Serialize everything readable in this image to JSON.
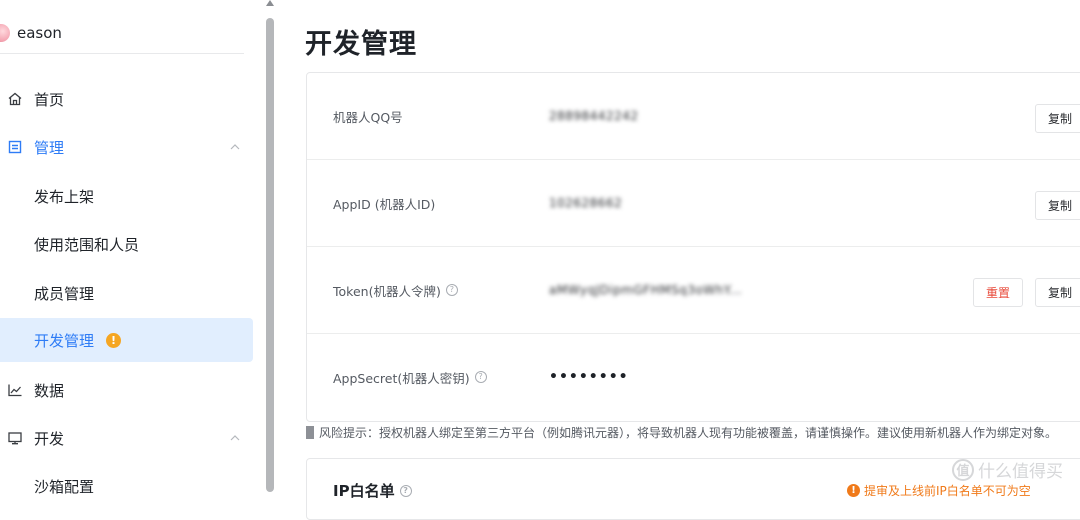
{
  "user": {
    "name": "eason"
  },
  "sidebar": {
    "items": [
      {
        "label": "首页",
        "icon": "home-icon"
      },
      {
        "label": "管理",
        "icon": "manage-icon",
        "expanded": true
      },
      {
        "label": "发布上架"
      },
      {
        "label": "使用范围和人员"
      },
      {
        "label": "成员管理"
      },
      {
        "label": "开发管理",
        "selected": true,
        "badge": "!"
      },
      {
        "label": "数据",
        "icon": "chart-icon"
      },
      {
        "label": "开发",
        "icon": "monitor-icon",
        "expanded": true
      },
      {
        "label": "沙箱配置"
      }
    ]
  },
  "main": {
    "title": "开发管理",
    "credentials": [
      {
        "label": "机器人QQ号",
        "value": "28898442242",
        "copy_label": "复制"
      },
      {
        "label": "AppID (机器人ID)",
        "value": "102628662",
        "copy_label": "复制"
      },
      {
        "label": "Token(机器人令牌)",
        "help": "?",
        "value": "aMWyqJDipmGFHMSq3oWhY...",
        "reset_label": "重置",
        "copy_label": "复制"
      },
      {
        "label": "AppSecret(机器人密钥)",
        "help": "?",
        "value": "••••••••"
      }
    ],
    "risk_tip": "风险提示：授权机器人绑定至第三方平台（例如腾讯元器），将导致机器人现有功能被覆盖，请谨慎操作。建议使用新机器人作为绑定对象。",
    "ip_whitelist": {
      "title": "IP白名单",
      "help": "?",
      "note": "提审及上线前IP白名单不可为空"
    }
  },
  "watermark": {
    "text": "什么值得买",
    "logo": "值"
  },
  "colors": {
    "accent": "#2e7cf6",
    "selected_bg": "#e1eefe",
    "danger": "#e84a3a",
    "warning": "#f5a623"
  }
}
